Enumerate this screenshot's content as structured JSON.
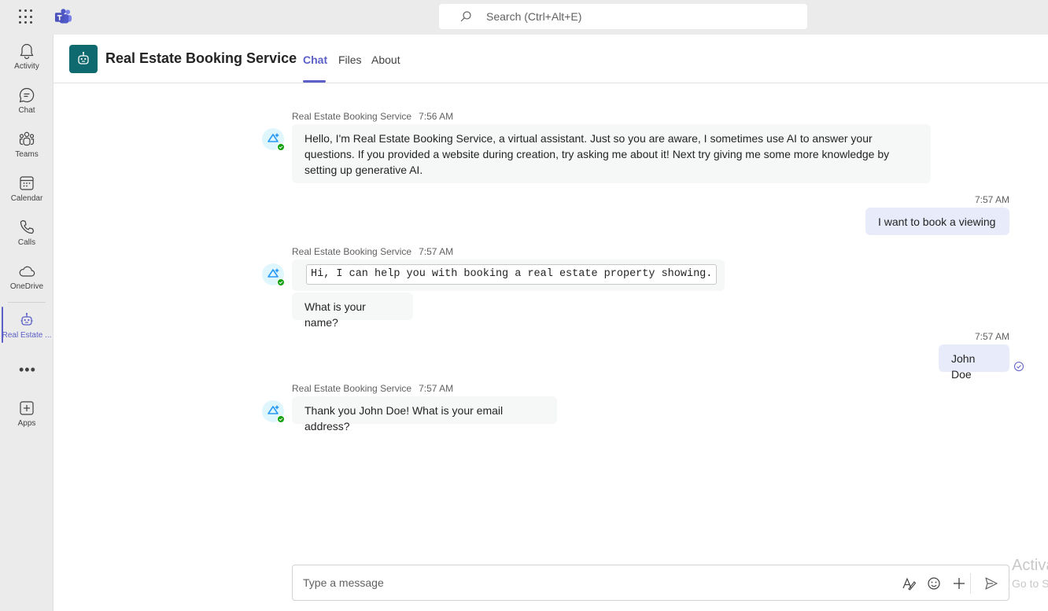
{
  "topbar": {
    "search_placeholder": "Search (Ctrl+Alt+E)"
  },
  "rail": {
    "items": [
      {
        "label": "Activity",
        "icon": "bell-icon"
      },
      {
        "label": "Chat",
        "icon": "chat-icon"
      },
      {
        "label": "Teams",
        "icon": "teams-icon"
      },
      {
        "label": "Calendar",
        "icon": "calendar-icon"
      },
      {
        "label": "Calls",
        "icon": "phone-icon"
      },
      {
        "label": "OneDrive",
        "icon": "cloud-icon"
      },
      {
        "label": "Real Estate ...",
        "icon": "bot-icon"
      },
      {
        "label": "Apps",
        "icon": "add-app-icon"
      }
    ],
    "more": "•••"
  },
  "header": {
    "title": "Real Estate Booking Service",
    "tabs": [
      {
        "label": "Chat",
        "active": true
      },
      {
        "label": "Files",
        "active": false
      },
      {
        "label": "About",
        "active": false
      }
    ]
  },
  "messages": [
    {
      "sender": "Real Estate Booking Service",
      "time": "7:56 AM",
      "text": "Hello, I'm Real Estate Booking Service, a virtual assistant. Just so you are aware, I sometimes use AI to answer your questions. If you provided a website during creation, try asking me about it! Next try giving me some more knowledge by setting up generative AI."
    },
    {
      "time": "7:57 AM",
      "text": "I want to book a viewing"
    },
    {
      "sender": "Real Estate Booking Service",
      "time": "7:57 AM",
      "code": "Hi, I can help you with booking a real estate property showing.",
      "text": "What is your name?"
    },
    {
      "time": "7:57 AM",
      "text": "John Doe"
    },
    {
      "sender": "Real Estate Booking Service",
      "time": "7:57 AM",
      "text": "Thank you John Doe! What is your email address?"
    }
  ],
  "compose": {
    "placeholder": "Type a message"
  },
  "watermark": {
    "line1": "Activa",
    "line2": "Go to S"
  },
  "colors": {
    "accent": "#5b5fc7",
    "app_avatar": "#0f6a6f",
    "bot_bubble": "#f5f8f6",
    "user_bubble": "#e8ebfa",
    "presence": "#13a10e"
  }
}
